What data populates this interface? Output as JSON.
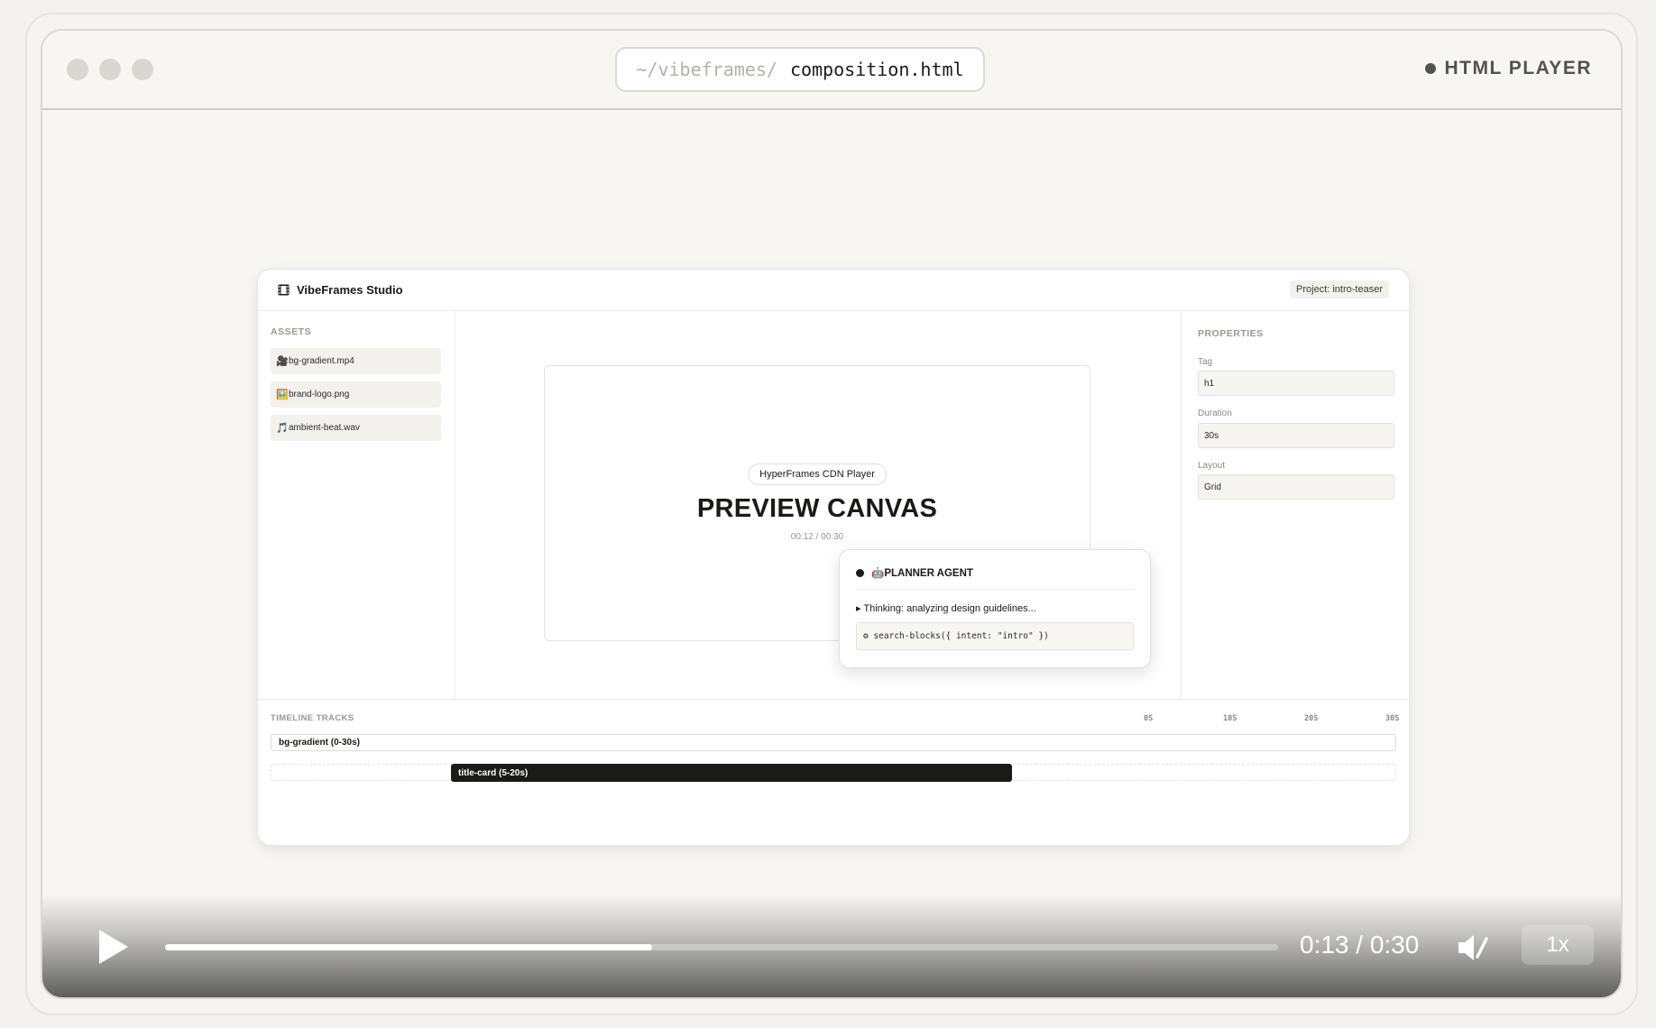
{
  "window": {
    "path_dir": "~/vibeframes/",
    "path_file": "composition.html",
    "badge_label": "HTML PLAYER"
  },
  "studio": {
    "title": "VibeFrames Studio",
    "project_tag": "Project: intro-teaser",
    "assets": {
      "label": "ASSETS",
      "items": [
        {
          "icon": "🎥",
          "name": "bg-gradient.mp4"
        },
        {
          "icon": "🖼️",
          "name": "brand-logo.png"
        },
        {
          "icon": "🎵",
          "name": "ambient-beat.wav"
        }
      ]
    },
    "properties": {
      "label": "PROPERTIES",
      "fields": [
        {
          "label": "Tag",
          "value": "h1"
        },
        {
          "label": "Duration",
          "value": "30s"
        },
        {
          "label": "Layout",
          "value": "Grid"
        }
      ]
    },
    "preview": {
      "pill": "HyperFrames CDN Player",
      "title": "PREVIEW CANVAS",
      "time": "00:12 / 00:30"
    },
    "agent": {
      "name": "🤖PLANNER AGENT",
      "thinking": "▸ Thinking: analyzing design guidelines...",
      "code": "⚙ search-blocks({ intent: \"intro\" })"
    },
    "timeline": {
      "label": "TIMELINE TRACKS",
      "ticks": [
        "0S",
        "10S",
        "20S",
        "30S"
      ],
      "tracks": [
        {
          "label": "bg-gradient (0-30s)"
        },
        {
          "label": "title-card (5-20s)"
        }
      ]
    }
  },
  "player": {
    "time": "0:13 / 0:30",
    "progress": 0.438,
    "speed": "1x"
  },
  "colors": {
    "page_bg": "#f4f2ee",
    "clip_bg": "#1c1a18",
    "accent_text": "#1c1a18"
  }
}
